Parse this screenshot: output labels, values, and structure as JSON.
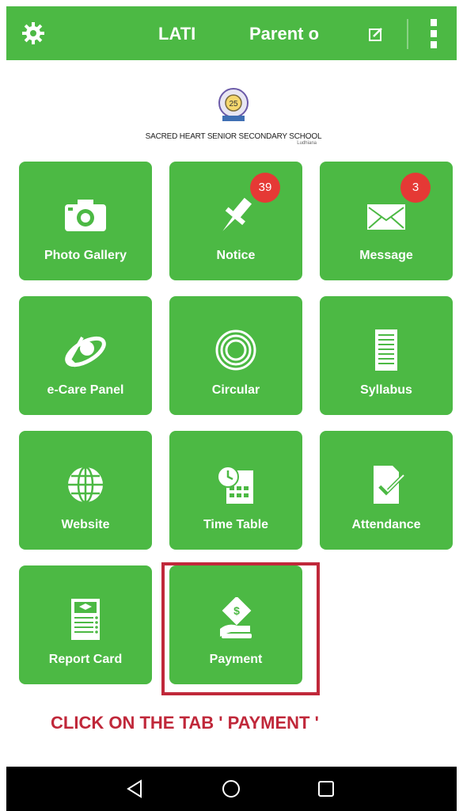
{
  "header": {
    "title": "LATI",
    "subtitle": "Parent o",
    "settings_icon": "gear-icon",
    "edit_icon": "edit-icon",
    "more_icon": "more-vert-icon"
  },
  "school": {
    "name": "SACRED HEART SENIOR SECONDARY SCHOOL",
    "city": "Ludhiana"
  },
  "tiles": [
    {
      "label": "Photo Gallery",
      "icon": "camera-icon"
    },
    {
      "label": "Notice",
      "icon": "pin-icon",
      "badge": "39"
    },
    {
      "label": "Message",
      "icon": "envelope-icon",
      "badge": "3"
    },
    {
      "label": "e-Care Panel",
      "icon": "ecare-icon"
    },
    {
      "label": "Circular",
      "icon": "circular-icon"
    },
    {
      "label": "Syllabus",
      "icon": "syllabus-icon"
    },
    {
      "label": "Website",
      "icon": "globe-icon"
    },
    {
      "label": "Time Table",
      "icon": "timetable-icon"
    },
    {
      "label": "Attendance",
      "icon": "attendance-icon"
    },
    {
      "label": "Report Card",
      "icon": "report-card-icon"
    },
    {
      "label": "Payment",
      "icon": "payment-icon"
    }
  ],
  "instruction": "CLICK ON THE TAB ' PAYMENT '",
  "colors": {
    "tile_green": "#4cb944",
    "badge_red": "#e53935",
    "highlight_red": "#c0283a"
  },
  "navbar": {
    "back_icon": "back-icon",
    "home_icon": "home-icon",
    "recents_icon": "recents-icon"
  }
}
